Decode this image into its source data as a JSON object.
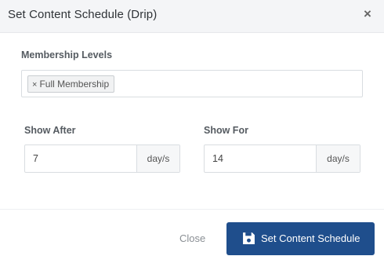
{
  "modal": {
    "title": "Set Content Schedule (Drip)",
    "close_icon": "close-icon"
  },
  "membership": {
    "label": "Membership Levels",
    "tags": [
      {
        "remove_glyph": "×",
        "label": "Full Membership"
      }
    ]
  },
  "show_after": {
    "label": "Show After",
    "value": "7",
    "unit": "day/s"
  },
  "show_for": {
    "label": "Show For",
    "value": "14",
    "unit": "day/s"
  },
  "footer": {
    "close_label": "Close",
    "submit_label": "Set Content Schedule",
    "submit_icon": "save-icon",
    "primary_color": "#1f4e8c"
  }
}
